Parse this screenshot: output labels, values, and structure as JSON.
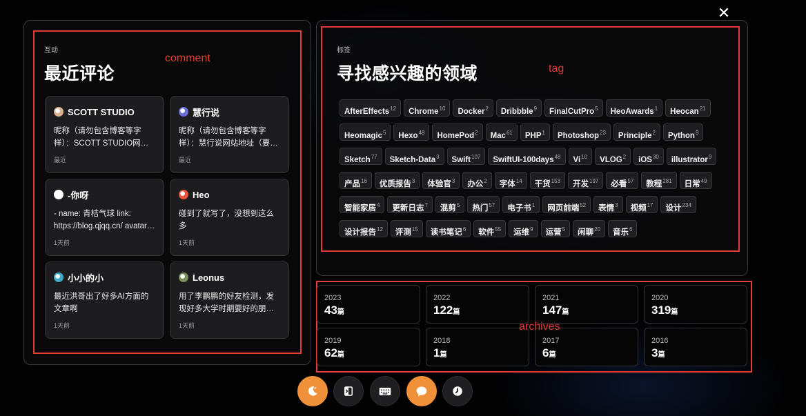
{
  "close": {
    "glyph": "✕"
  },
  "comments": {
    "label": "互动",
    "title": "最近评论",
    "annotation": "comment",
    "items": [
      {
        "name": "SCOTT STUDIO",
        "text": "昵称（请勿包含博客等字样）：SCOTT STUDIO网站地址（要求博客地址",
        "time": "最近",
        "avatar_color": "#d9b48f"
      },
      {
        "name": "慧行说",
        "text": "昵称（请勿包含博客等字样）：慧行说网站地址（要求博客地址，请勿提交",
        "time": "最近",
        "avatar_color": "#6b6fd6"
      },
      {
        "name": "-你呀",
        "text": "- name: 青桔气球 link: https://blog.qjqq.cn/ avatar: https",
        "time": "1天前",
        "avatar_color": "#ffffff"
      },
      {
        "name": "Heo",
        "text": "碰到了就写了，没想到这么多",
        "time": "1天前",
        "avatar_color": "#e8553a"
      },
      {
        "name": "小小的小",
        "text": "最近洪哥出了好多AI方面的文章啊",
        "time": "1天前",
        "avatar_color": "#3fa9c9"
      },
      {
        "name": "Leonus",
        "text": "用了李鹏鹏的好友检测，发现好多大学时期要好的朋友、同学都不更新了",
        "time": "1天前",
        "avatar_color": "#7a8f5a"
      }
    ]
  },
  "tags": {
    "label": "标签",
    "title": "寻找感兴趣的领域",
    "annotation": "tag",
    "items": [
      {
        "name": "AfterEffects",
        "count": "12"
      },
      {
        "name": "Chrome",
        "count": "10"
      },
      {
        "name": "Docker",
        "count": "2"
      },
      {
        "name": "Dribbble",
        "count": "9"
      },
      {
        "name": "FinalCutPro",
        "count": "5"
      },
      {
        "name": "HeoAwards",
        "count": "1"
      },
      {
        "name": "Heocan",
        "count": "21"
      },
      {
        "name": "Heomagic",
        "count": "5"
      },
      {
        "name": "Hexo",
        "count": "48"
      },
      {
        "name": "HomePod",
        "count": "2"
      },
      {
        "name": "Mac",
        "count": "61"
      },
      {
        "name": "PHP",
        "count": "1"
      },
      {
        "name": "Photoshop",
        "count": "23"
      },
      {
        "name": "Principle",
        "count": "2"
      },
      {
        "name": "Python",
        "count": "9"
      },
      {
        "name": "Sketch",
        "count": "77"
      },
      {
        "name": "Sketch-Data",
        "count": "3"
      },
      {
        "name": "Swift",
        "count": "107"
      },
      {
        "name": "SwiftUI-100days",
        "count": "48"
      },
      {
        "name": "Vi",
        "count": "10"
      },
      {
        "name": "VLOG",
        "count": "2"
      },
      {
        "name": "iOS",
        "count": "30"
      },
      {
        "name": "illustrator",
        "count": "9"
      },
      {
        "name": "产品",
        "count": "16"
      },
      {
        "name": "优质报告",
        "count": "3"
      },
      {
        "name": "体验官",
        "count": "3"
      },
      {
        "name": "办公",
        "count": "2"
      },
      {
        "name": "字体",
        "count": "14"
      },
      {
        "name": "干货",
        "count": "153"
      },
      {
        "name": "开发",
        "count": "197"
      },
      {
        "name": "必看",
        "count": "57"
      },
      {
        "name": "教程",
        "count": "281"
      },
      {
        "name": "日常",
        "count": "49"
      },
      {
        "name": "智能家居",
        "count": "4"
      },
      {
        "name": "更新日志",
        "count": "7"
      },
      {
        "name": "混剪",
        "count": "5"
      },
      {
        "name": "热门",
        "count": "57"
      },
      {
        "name": "电子书",
        "count": "1"
      },
      {
        "name": "网页前端",
        "count": "52"
      },
      {
        "name": "表情",
        "count": "3"
      },
      {
        "name": "视频",
        "count": "17"
      },
      {
        "name": "设计",
        "count": "234"
      },
      {
        "name": "设计报告",
        "count": "12"
      },
      {
        "name": "评测",
        "count": "15"
      },
      {
        "name": "读书笔记",
        "count": "6"
      },
      {
        "name": "软件",
        "count": "55"
      },
      {
        "name": "运维",
        "count": "9"
      },
      {
        "name": "运营",
        "count": "5"
      },
      {
        "name": "闲聊",
        "count": "20"
      },
      {
        "name": "音乐",
        "count": "6"
      }
    ]
  },
  "archives": {
    "annotation": "archives",
    "unit": "篇",
    "items": [
      {
        "year": "2023",
        "count": "43"
      },
      {
        "year": "2022",
        "count": "122"
      },
      {
        "year": "2021",
        "count": "147"
      },
      {
        "year": "2020",
        "count": "319"
      },
      {
        "year": "2019",
        "count": "62"
      },
      {
        "year": "2018",
        "count": "1"
      },
      {
        "year": "2017",
        "count": "6"
      },
      {
        "year": "2016",
        "count": "3"
      }
    ]
  },
  "dock": [
    {
      "icon": "moon-icon",
      "active": true
    },
    {
      "icon": "sidebar-toggle-icon",
      "active": false
    },
    {
      "icon": "keyboard-icon",
      "active": false
    },
    {
      "icon": "comment-bubble-icon",
      "active": true
    },
    {
      "icon": "clock-icon",
      "active": false
    }
  ]
}
